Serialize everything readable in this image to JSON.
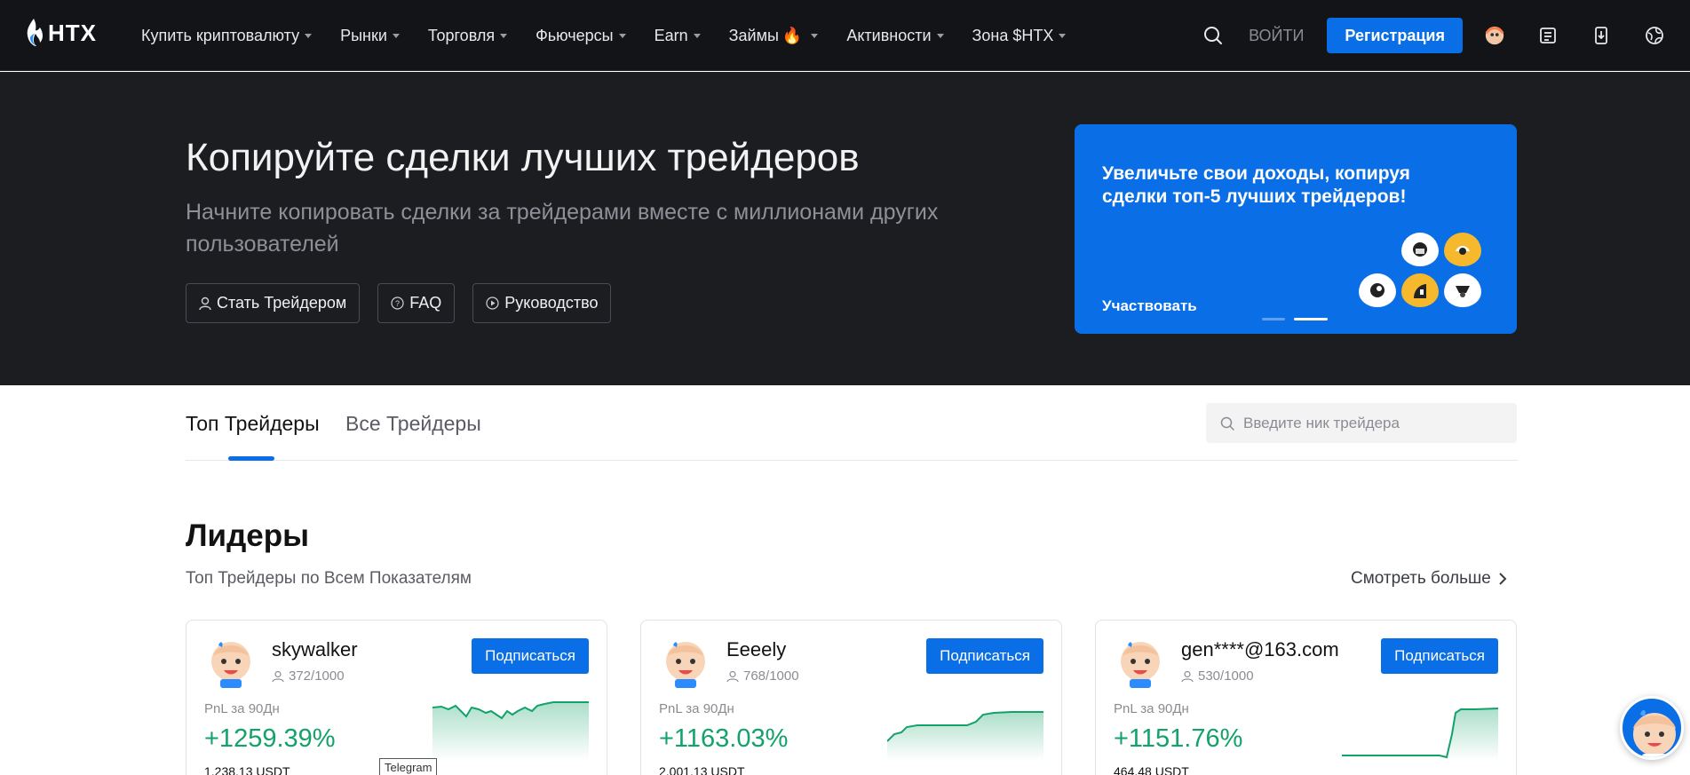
{
  "header": {
    "brand": "HTX",
    "nav": [
      {
        "label": "Купить криптовалюту",
        "dropdown": true
      },
      {
        "label": "Рынки",
        "dropdown": true
      },
      {
        "label": "Торговля",
        "dropdown": true
      },
      {
        "label": "Фьючерсы",
        "dropdown": true
      },
      {
        "label": "Earn",
        "dropdown": true
      },
      {
        "label": "Займы",
        "dropdown": true,
        "badge": "🔥"
      },
      {
        "label": "Активности",
        "dropdown": true
      },
      {
        "label": "Зона $HTX",
        "dropdown": true
      }
    ],
    "login": "ВОЙТИ",
    "register": "Регистрация",
    "icons": [
      "search-icon",
      "avatar-icon",
      "orders-icon",
      "download-icon",
      "language-icon"
    ]
  },
  "hero": {
    "title": "Копируйте сделки лучших трейдеров",
    "subtitle": "Начните копировать сделки за трейдерами вместе с миллионами других пользователей",
    "buttons": {
      "become_trader": "Стать Трейдером",
      "faq": "FAQ",
      "guide": "Руководство"
    },
    "promo": {
      "title": "Увеличьте свои доходы, копируя сделки топ-5 лучших трейдеров!",
      "link": "Участвовать",
      "slides": 2,
      "active_slide": 2
    }
  },
  "tabs": {
    "items": [
      "Топ Трейдеры",
      "Все Трейдеры"
    ],
    "active": 0,
    "search_placeholder": "Введите ник трейдера"
  },
  "leaders": {
    "title": "Лидеры",
    "subtitle": "Топ Трейдеры по Всем Показателям",
    "more": "Смотреть больше",
    "cards": [
      {
        "name": "skywalker",
        "followers": "372/1000",
        "subscribe": "Подписаться",
        "pnl_label": "PnL за 90Дн",
        "pnl": "+1259.39%",
        "amount": "1,238.13 USDT"
      },
      {
        "name": "Eeeely",
        "followers": "768/1000",
        "subscribe": "Подписаться",
        "pnl_label": "PnL за 90Дн",
        "pnl": "+1163.03%",
        "amount": "2,001.13 USDT"
      },
      {
        "name": "gen****@163.com",
        "followers": "530/1000",
        "subscribe": "Подписаться",
        "pnl_label": "PnL за 90Дн",
        "pnl": "+1151.76%",
        "amount": "464.48 USDT"
      }
    ]
  },
  "tooltip": "Telegram",
  "colors": {
    "accent": "#0a6fe6",
    "positive": "#13a269",
    "header_bg": "#131418",
    "hero_bg": "#1c1d21"
  }
}
